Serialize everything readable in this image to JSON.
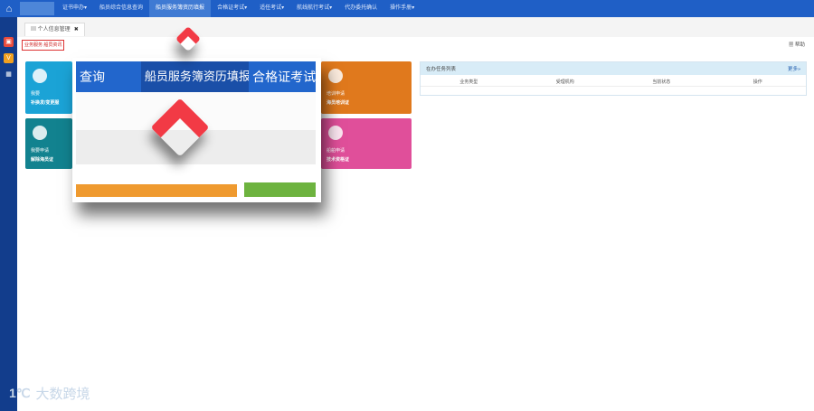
{
  "nav": {
    "items": [
      "证书申办",
      "船员综合信息查询",
      "船员服务簿资历填报",
      "合格证考试",
      "适任考试",
      "航线航行考试",
      "代办委托确认",
      "操作手册"
    ],
    "active_index": 2
  },
  "tab": {
    "label": "个人信息管理",
    "close": "✖"
  },
  "breadcrumb": "业务服务 船员资讯",
  "help": "帮助",
  "tiles": [
    {
      "line1": "我要",
      "line2": "补换发/变更服",
      "color": "#1ba3d6"
    },
    {
      "line1": "我要申请",
      "line2": "解除海员证",
      "color": "#12828f"
    },
    {
      "line1": "培训申请",
      "line2": "海员培训证",
      "color": "#e0791d"
    },
    {
      "line1": "船舶申请",
      "line2": "技术资格证",
      "color": "#e04f9a"
    }
  ],
  "task": {
    "title": "在办任务列表",
    "more": "更多»",
    "columns": [
      "业务类型",
      "受理机构",
      "当前状态",
      "操作"
    ]
  },
  "popup": {
    "items": [
      "查询",
      "船员服务簿资历填报",
      "合格证考试"
    ],
    "active_index": 1
  },
  "watermark": {
    "logo": "1℃",
    "text": "大数跨境"
  }
}
